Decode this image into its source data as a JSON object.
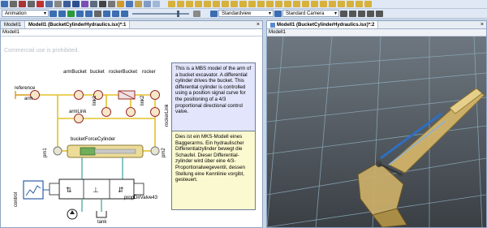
{
  "toolbar": {
    "mode_label": "Animation",
    "view_dropdown": "Standardview",
    "camera_dropdown": "Standard Camera"
  },
  "left_pane": {
    "tab_inactive": "Modell1",
    "tab_active": "Modell1 (BucketCylinderHydraulics.isx)*:1",
    "address": "Modell1",
    "watermark": "Commercial use is prohibited."
  },
  "right_pane": {
    "tab_active": "Modell1 (BucketCylinderHydraulics.isx)*:2",
    "address": "Modell1"
  },
  "diagram": {
    "labels": {
      "reference": "reference",
      "arm": "arm",
      "armBucket": "armBucket",
      "bucket": "bucket",
      "rockerBucket": "rockerBucket",
      "rocker": "rocker",
      "link1": "link1",
      "link2": "link2",
      "rockerLink": "rockerLink",
      "armLink": "armLink",
      "pm1": "pm1",
      "pm2": "pm2",
      "bucketForceCylinder": "bucketForceCylinder",
      "control": "control",
      "propDirValve43": "propDirValve43",
      "pump": "pump",
      "tank": "tank"
    }
  },
  "notes": {
    "english": "This is a MBS model of the arm of a bucket excavator. A differential cylinder drives the bucket. This differential cylinder is controlled using a position signal curve for the positioning of a 4/3 proportional directional control valve.",
    "german": "Dies ist ein MKS-Modell eines Baggerarms. Ein hydraulischer Differentialzylinder bewegt die Schaufel. Dieser Differential-zylinder wird über eine 4/3-Proportionalwegeventil, dessen Stellung eine Kennlinie vorgibt, gesteuert."
  }
}
